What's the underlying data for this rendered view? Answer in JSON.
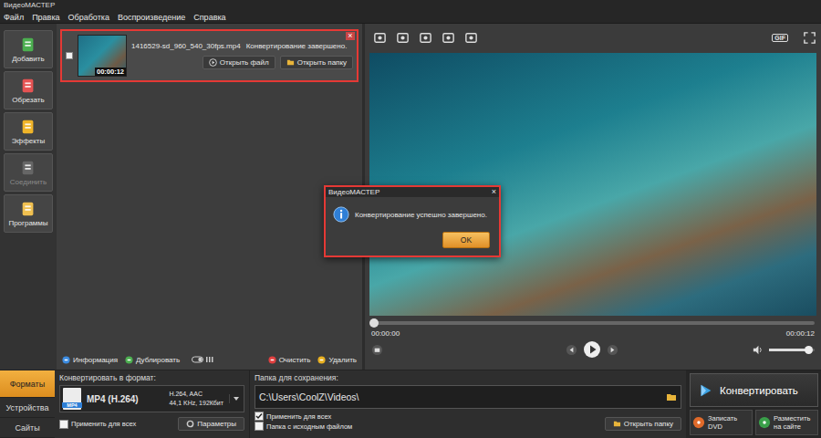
{
  "window": {
    "title": "ВидеоМАСТЕР"
  },
  "menu": [
    "Файл",
    "Правка",
    "Обработка",
    "Воспроизведение",
    "Справка"
  ],
  "toolbar": [
    {
      "label": "Добавить",
      "disabled": false
    },
    {
      "label": "Обрезать",
      "disabled": false
    },
    {
      "label": "Эффекты",
      "disabled": false
    },
    {
      "label": "Соединить",
      "disabled": true
    },
    {
      "label": "Программы",
      "disabled": false
    }
  ],
  "file_list": {
    "items": [
      {
        "name": "1416529-sd_960_540_30fps.mp4",
        "status": "Конвертирование завершено.",
        "duration": "00:00:12",
        "checked": false,
        "close": "×",
        "buttons": [
          "Открыть файл",
          "Открыть папку"
        ]
      }
    ],
    "actions": [
      "Информация",
      "Дублировать",
      "Очистить",
      "Удалить"
    ]
  },
  "preview_tools": {
    "gif_label": "GIF"
  },
  "player": {
    "position": "00:00:00",
    "duration": "00:00:12",
    "progress": 0,
    "volume": 0.85
  },
  "bottom_tabs": [
    {
      "label": "Форматы",
      "selected": true
    },
    {
      "label": "Устройства",
      "selected": false
    },
    {
      "label": "Сайты",
      "selected": false
    }
  ],
  "format": {
    "heading": "Конвертировать в формат:",
    "name": "MP4 (H.264)",
    "badge": "MP4",
    "codec": "H.264, AAC",
    "audio": "44,1 KHz, 192Кбит",
    "apply_all": {
      "label": "Применить для всех",
      "checked": false
    },
    "params_button": "Параметры"
  },
  "output": {
    "heading": "Папка для сохранения:",
    "path": "C:\\Users\\CoolZ\\Videos\\",
    "options": [
      {
        "label": "Применить для всех",
        "checked": true
      },
      {
        "label": "Папка с исходным файлом",
        "checked": false
      }
    ],
    "open_button": "Открыть папку"
  },
  "convert": {
    "label": "Конвертировать"
  },
  "extras": [
    "Записать DVD",
    "Разместить на сайте"
  ],
  "dialog": {
    "title": "ВидеоМАСТЕР",
    "close": "×",
    "message": "Конвертирование успешно завершено.",
    "button": "OK"
  }
}
